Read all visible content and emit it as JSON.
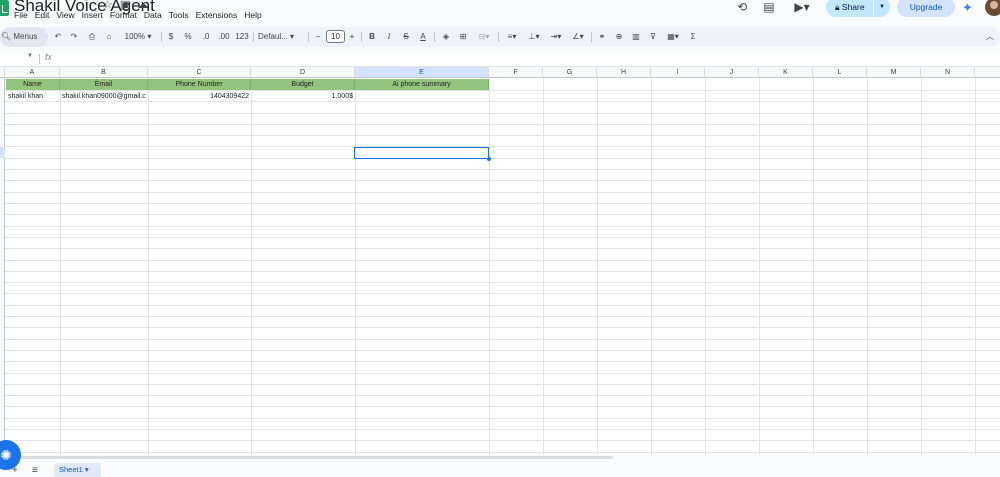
{
  "doc": {
    "title": "Shakil Voice Agent"
  },
  "menu": [
    "File",
    "Edit",
    "View",
    "Insert",
    "Format",
    "Data",
    "Tools",
    "Extensions",
    "Help"
  ],
  "header": {
    "share_label": "Share",
    "upgrade_label": "Upgrade"
  },
  "toolbar": {
    "menus_label": "Menus",
    "zoom": "100%",
    "currency": "$",
    "percent": "%",
    "dec_decrease": ".0",
    "dec_increase": ".00",
    "number_format": "123",
    "font": "Defaul...",
    "font_size": "10",
    "minus": "−",
    "plus": "+",
    "bold": "B",
    "italic": "I",
    "strike": "S",
    "textcolor": "A",
    "sum": "Σ"
  },
  "formula": {
    "fx": "fx"
  },
  "columns": [
    "A",
    "B",
    "C",
    "D",
    "E",
    "F",
    "G",
    "H",
    "I",
    "J",
    "K",
    "L",
    "M",
    "N"
  ],
  "table": {
    "headers": [
      "Name",
      "Email",
      "Phone Number",
      "Budget",
      "Ai phone summary"
    ],
    "rows": [
      [
        "shakil khan",
        "shakil.khan09000@gmail.c",
        "1404309422",
        "1,000$",
        ""
      ]
    ]
  },
  "sheets": [
    {
      "label": "Sheet1"
    }
  ],
  "colors": {
    "header_green": "#93c47d",
    "accent": "#1a73e8"
  }
}
